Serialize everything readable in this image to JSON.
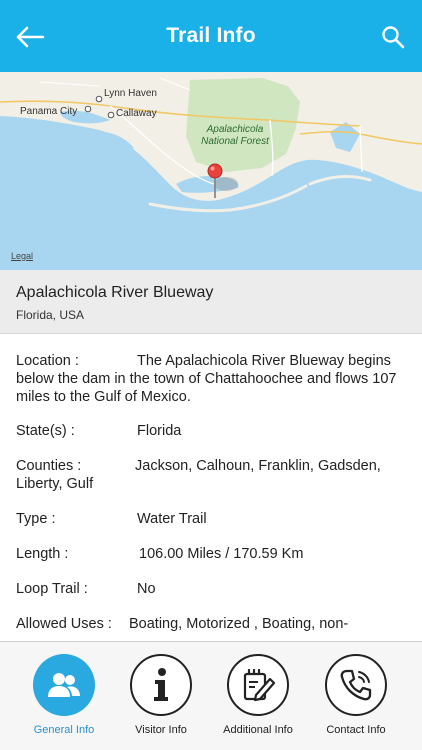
{
  "header": {
    "title": "Trail Info"
  },
  "map": {
    "labels": {
      "lynn_haven": "Lynn Haven",
      "panama_city": "Panama City",
      "callaway": "Callaway",
      "forest": "Apalachicola National Forest"
    },
    "legal": "Legal"
  },
  "trail": {
    "name": "Apalachicola River Blueway",
    "location": "Florida, USA"
  },
  "details": {
    "location_label": "Location  :",
    "location_value_first": "The Apalachicola River Blueway begins",
    "location_value_rest": "below the dam in the town of Chattahoochee and flows 107 miles to the Gulf of Mexico.",
    "state_label": "State(s)  :",
    "state_value": "Florida",
    "counties_label": "Counties  :",
    "counties_value_first": "Jackson, Calhoun, Franklin, Gadsden,",
    "counties_value_rest": "Liberty, Gulf",
    "type_label": "Type  :",
    "type_value": "Water Trail",
    "length_label": "Length  :",
    "length_value": "106.00 Miles / 170.59 Km",
    "loop_label": "Loop Trail  :",
    "loop_value": "No",
    "uses_label": "Allowed Uses  :",
    "uses_value": "Boating, Motorized , Boating, non-"
  },
  "nav": {
    "general": "General Info",
    "visitor": "Visitor Info",
    "additional": "Additional Info",
    "contact": "Contact Info"
  },
  "colors": {
    "header": "#1ab0e8",
    "active_nav": "#2aa8e0",
    "active_label": "#2a8fd0",
    "pin": "#e8423c"
  }
}
